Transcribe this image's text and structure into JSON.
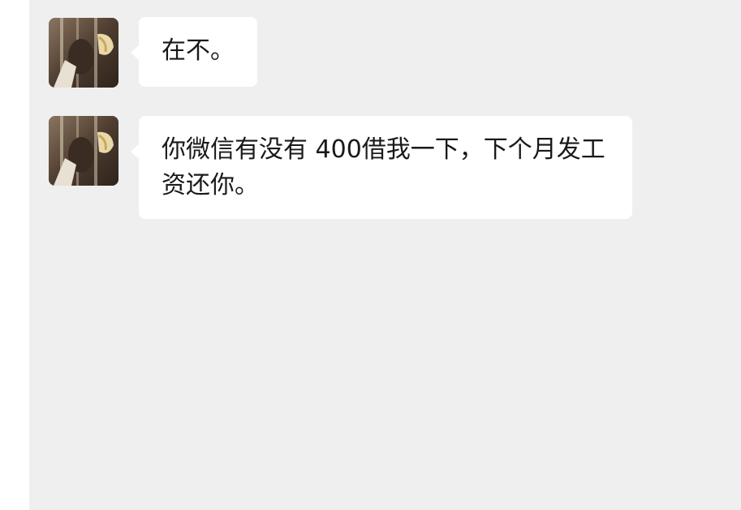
{
  "chat": {
    "messages": [
      {
        "sender": "contact",
        "text": "在不。"
      },
      {
        "sender": "contact",
        "text": "你微信有没有 400借我一下，下个月发工资还你。"
      }
    ]
  },
  "colors": {
    "chat_background": "#efefef",
    "bubble_background": "#ffffff",
    "text": "#191919"
  },
  "icons": {
    "avatar": "contact-avatar-photo"
  }
}
